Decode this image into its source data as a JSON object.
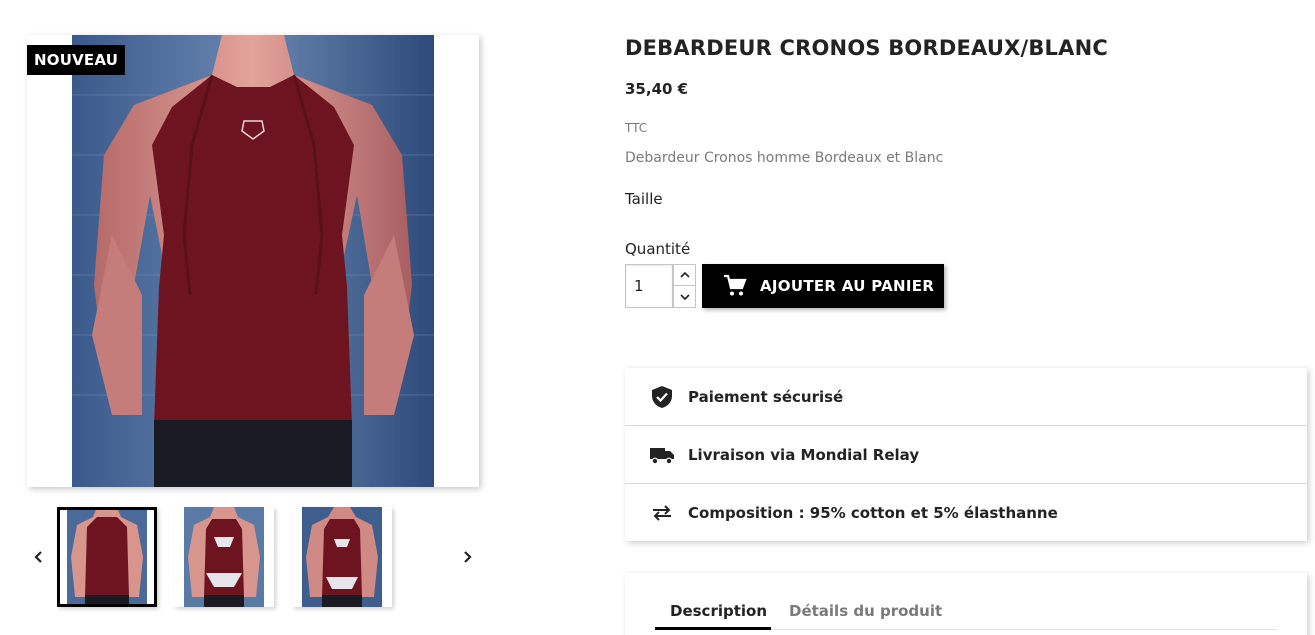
{
  "gallery": {
    "badge": "NOUVEAU",
    "thumbnails": [
      {
        "alt": "thumbnail-back",
        "selected": true
      },
      {
        "alt": "thumbnail-front",
        "selected": false
      },
      {
        "alt": "thumbnail-front-2",
        "selected": false
      }
    ],
    "prev_icon": "chevron-left-icon",
    "next_icon": "chevron-right-icon"
  },
  "product": {
    "title": "DEBARDEUR CRONOS BORDEAUX/BLANC",
    "price": "35,40 €",
    "tax_label": "TTC",
    "short_description": "Debardeur Cronos homme Bordeaux et Blanc",
    "size_label": "Taille",
    "quantity_label": "Quantité",
    "quantity_value": "1",
    "add_to_cart_label": "AJOUTER AU PANIER",
    "cart_icon": "shopping-cart-icon"
  },
  "reassurance": [
    {
      "icon": "shield-check-icon",
      "text": "Paiement sécurisé"
    },
    {
      "icon": "truck-icon",
      "text": "Livraison via Mondial Relay"
    },
    {
      "icon": "swap-arrows-icon",
      "text": "Composition : 95% cotton et 5% élasthanne"
    }
  ],
  "tabs": [
    {
      "label": "Description",
      "active": true
    },
    {
      "label": "Détails du produit",
      "active": false
    }
  ],
  "colors": {
    "accent": "#000000",
    "text": "#232323",
    "muted": "#7a7a7a",
    "shirt": "#6e1420"
  }
}
